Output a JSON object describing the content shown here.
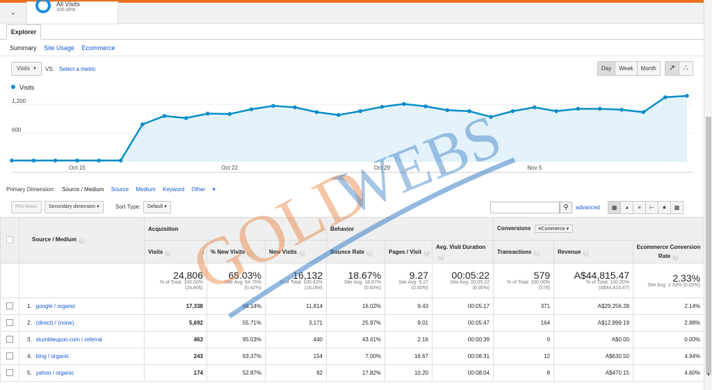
{
  "segment": {
    "name": "All Visits",
    "pct": "100.00%"
  },
  "tabs": {
    "explorer": "Explorer"
  },
  "subtabs": {
    "summary": "Summary",
    "site_usage": "Site Usage",
    "ecommerce": "Ecommerce"
  },
  "metric": {
    "selected": "Visits",
    "vs": "VS.",
    "select_metric": "Select a metric"
  },
  "period": {
    "day": "Day",
    "week": "Week",
    "month": "Month"
  },
  "chart_data": {
    "type": "area",
    "legend": "Visits",
    "color": "#058dc7",
    "y_ticks": [
      "1,200",
      "600"
    ],
    "x_labels": [
      "Oct 15",
      "Oct 22",
      "Oct 29",
      "Nov 5"
    ],
    "ylim": [
      0,
      1450
    ],
    "values": [
      30,
      30,
      30,
      30,
      30,
      30,
      785,
      960,
      915,
      1010,
      1000,
      1100,
      1170,
      1140,
      1040,
      980,
      1060,
      1150,
      1210,
      1160,
      1080,
      1060,
      940,
      1060,
      1140,
      1060,
      1110,
      1110,
      1090,
      1040,
      1350,
      1380
    ]
  },
  "primary_dimension": {
    "label": "Primary Dimension:",
    "current": "Source / Medium",
    "options": [
      "Source",
      "Medium",
      "Keyword",
      "Other"
    ]
  },
  "toolbar": {
    "plot_rows": "Plot Rows",
    "secondary": "Secondary dimension",
    "sort_type_label": "Sort Type:",
    "sort_default": "Default",
    "advanced": "advanced"
  },
  "table": {
    "groups": {
      "acquisition": "Acquisition",
      "behavior": "Behavior",
      "conversions": "Conversions",
      "conversions_select": "eCommerce"
    },
    "source_header": "Source / Medium",
    "columns": [
      "Visits",
      "% New Visits",
      "New Visits",
      "Bounce Rate",
      "Pages / Visit",
      "Avg. Visit Duration",
      "Transactions",
      "Revenue",
      "Ecommerce Conversion Rate"
    ],
    "totals": [
      {
        "big": "24,806",
        "l1": "% of Total: 100.00%",
        "l2": "(24,806)"
      },
      {
        "big": "65.03%",
        "l1": "Site Avg: 64.76%",
        "l2": "(0.42%)"
      },
      {
        "big": "16,132",
        "l1": "% of Total: 100.42%",
        "l2": "(16,064)"
      },
      {
        "big": "18.67%",
        "l1": "Site Avg: 18.67%",
        "l2": "(0.00%)"
      },
      {
        "big": "9.27",
        "l1": "Site Avg: 9.27",
        "l2": "(0.00%)"
      },
      {
        "big": "00:05:22",
        "l1": "Site Avg: 00:05:22",
        "l2": "(0.00%)"
      },
      {
        "big": "579",
        "l1": "% of Total: 100.00%",
        "l2": "(579)"
      },
      {
        "big": "A$44,815.47",
        "l1": "% of Total: 100.00%",
        "l2": "(A$44,815.47)"
      },
      {
        "big": "2.33%",
        "l1": "Site Avg: 2.33% (0.00%)",
        "l2": ""
      }
    ],
    "rows": [
      {
        "num": "1.",
        "source": "google / organic",
        "cells": [
          "17,338",
          "68.14%",
          "11,814",
          "16.02%",
          "9.43",
          "00:05:17",
          "371",
          "A$29,256.28",
          "2.14%"
        ]
      },
      {
        "num": "2.",
        "source": "(direct) / (none)",
        "cells": [
          "5,692",
          "55.71%",
          "3,171",
          "25.97%",
          "9.01",
          "00:05:47",
          "164",
          "A$12,899.19",
          "2.88%"
        ]
      },
      {
        "num": "3.",
        "source": "stumbleupon.com / referral",
        "cells": [
          "463",
          "95.03%",
          "440",
          "43.41%",
          "2.16",
          "00:00:39",
          "0",
          "A$0.00",
          "0.00%"
        ]
      },
      {
        "num": "4.",
        "source": "bing / organic",
        "cells": [
          "243",
          "63.37%",
          "154",
          "7.00%",
          "16.67",
          "00:08:31",
          "12",
          "A$630.50",
          "4.94%"
        ]
      },
      {
        "num": "5.",
        "source": "yahoo / organic",
        "cells": [
          "174",
          "52.87%",
          "92",
          "17.82%",
          "10.20",
          "00:08:04",
          "8",
          "A$470.15",
          "4.60%"
        ]
      }
    ]
  },
  "watermark": {
    "text1": "GOLD",
    "text2": "WEBS"
  }
}
